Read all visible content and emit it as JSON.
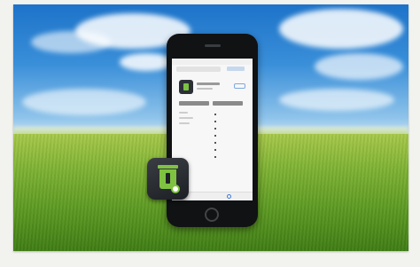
{
  "scene": {
    "description_free": true,
    "colors": {
      "sky": "#1d73c9",
      "grass": "#6aa52a",
      "phone_body": "#101214",
      "app_icon_bg": "#2c3036",
      "app_accent": "#7cc242"
    },
    "icons": {
      "app_icon": "green-bin-icon",
      "search_tab_icon": "search-icon"
    }
  }
}
